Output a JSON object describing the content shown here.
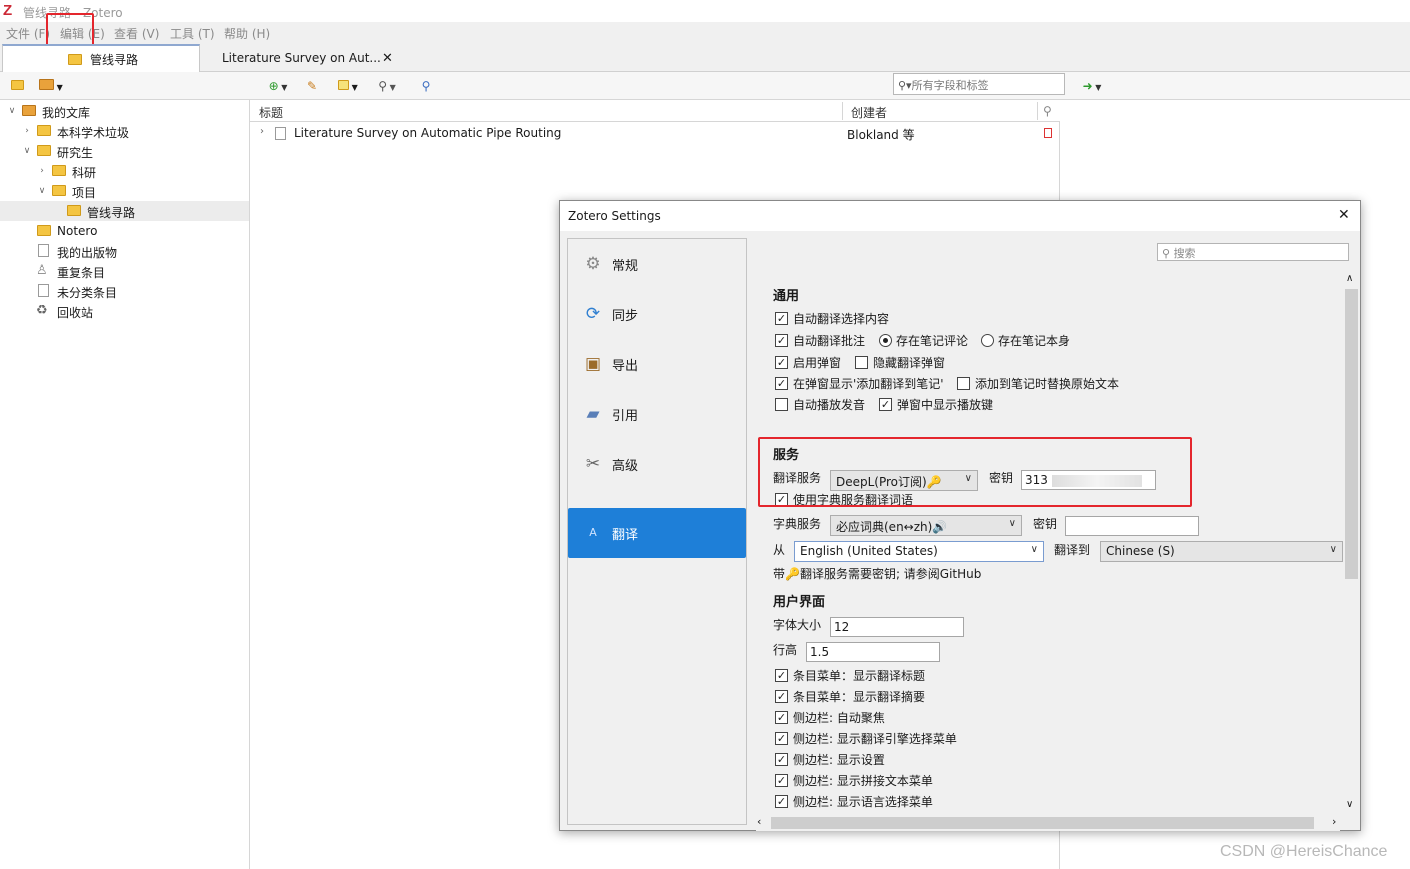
{
  "window": {
    "title": "管线寻路 - Zotero",
    "app_logo": "Z"
  },
  "menubar": {
    "items": [
      "文件 (F)",
      "编辑 (E)",
      "查看 (V)",
      "工具 (T)",
      "帮助 (H)"
    ]
  },
  "tabs": [
    {
      "label": "管线寻路"
    },
    {
      "label": "Literature Survey on Aut..."
    }
  ],
  "tab_close": "✕",
  "toolbar": {
    "search_placeholder": "所有字段和标签"
  },
  "collections": [
    {
      "label": "我的文库"
    },
    {
      "label": "本科学术垃圾"
    },
    {
      "label": "研究生"
    },
    {
      "label": "科研"
    },
    {
      "label": "项目"
    },
    {
      "label": "管线寻路"
    },
    {
      "label": "Notero"
    },
    {
      "label": "我的出版物"
    },
    {
      "label": "重复条目"
    },
    {
      "label": "未分类条目"
    },
    {
      "label": "回收站"
    }
  ],
  "items_table": {
    "columns": {
      "title": "标题",
      "creator": "创建者"
    },
    "rows": [
      {
        "title": "Literature Survey on Automatic Pipe Routing",
        "creator": "Blokland 等"
      }
    ]
  },
  "dialog": {
    "title": "Zotero Settings",
    "close": "✕",
    "search_placeholder": "搜索",
    "nav": [
      {
        "label": "常规",
        "icon": "gear-icon"
      },
      {
        "label": "同步",
        "icon": "sync-icon"
      },
      {
        "label": "导出",
        "icon": "clipboard-icon"
      },
      {
        "label": "引用",
        "icon": "folder-icon"
      },
      {
        "label": "高级",
        "icon": "tools-icon"
      },
      {
        "label": "翻译",
        "icon": "translate-icon"
      }
    ],
    "general": {
      "heading": "通用",
      "auto_translate_selection": "自动翻译选择内容",
      "auto_translate_annotation": "自动翻译批注",
      "save_in_note_comment": "存在笔记评论",
      "save_in_note_body": "存在笔记本身",
      "enable_popup": "启用弹窗",
      "hide_translate_popup": "隐藏翻译弹窗",
      "show_add_to_note": "在弹窗显示'添加翻译到笔记'",
      "replace_original_text": "添加到笔记时替换原始文本",
      "auto_play_audio": "自动播放发音",
      "show_play_button": "弹窗中显示播放键"
    },
    "service": {
      "heading": "服务",
      "translate_service_label": "翻译服务",
      "translate_service_value": "DeepL(Pro订阅)🔑",
      "secret_label": "密钥",
      "secret_value": "313",
      "use_dict_service": "使用字典服务翻译词语",
      "dict_service_label": "字典服务",
      "dict_service_value": "必应词典(en↔zh)🔊",
      "dict_secret_label": "密钥",
      "dict_secret_value": "",
      "from_label": "从",
      "from_value": "English (United States)",
      "to_label": "翻译到",
      "to_value": "Chinese (S)",
      "note": "带🔑翻译服务需要密钥; 请参阅GitHub"
    },
    "ui": {
      "heading": "用户界面",
      "font_size_label": "字体大小",
      "font_size_value": "12",
      "line_height_label": "行高",
      "line_height_value": "1.5",
      "options": [
        "条目菜单：显示翻译标题",
        "条目菜单：显示翻译摘要",
        "侧边栏: 自动聚焦",
        "侧边栏: 显示翻译引擎选择菜单",
        "侧边栏: 显示设置",
        "侧边栏: 显示拼接文本菜单",
        "侧边栏: 显示语言选择菜单"
      ]
    }
  },
  "watermark": "CSDN @HereisChance",
  "colors": {
    "accent": "#1e7fd8",
    "highlight_box": "#e4262d",
    "logo": "#cc2936"
  }
}
